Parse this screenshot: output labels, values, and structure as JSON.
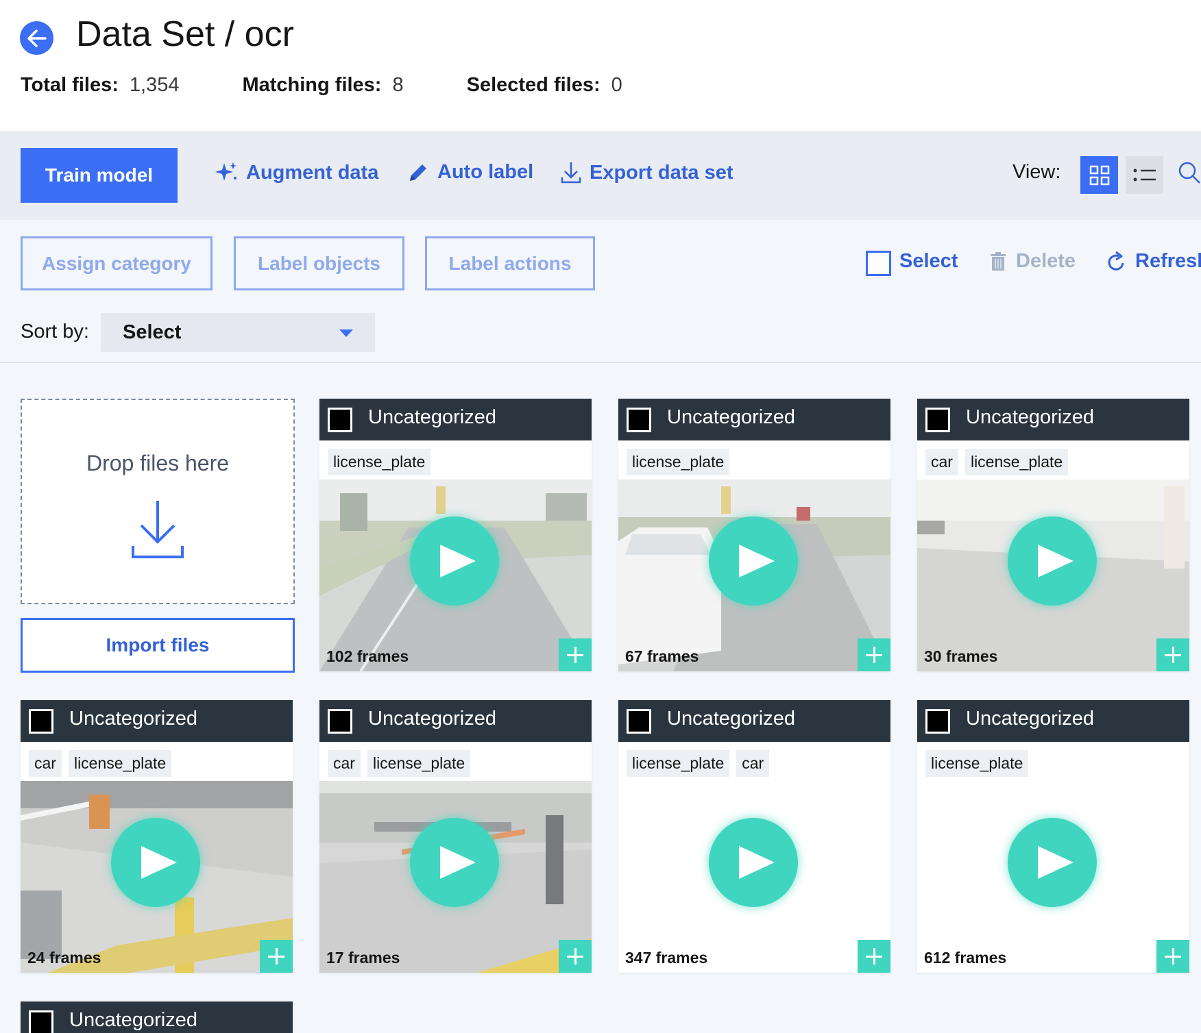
{
  "header": {
    "title": "Data Set / ocr",
    "stats": [
      {
        "label": "Total files:",
        "value": "1,354"
      },
      {
        "label": "Matching files:",
        "value": "8"
      },
      {
        "label": "Selected files:",
        "value": "0"
      }
    ]
  },
  "toolbar": {
    "train_label": "Train model",
    "augment_label": "Augment data",
    "auto_label": "Auto label",
    "export_label": "Export data set",
    "view_label": "View:"
  },
  "actions": {
    "assign_category": "Assign category",
    "label_objects": "Label objects",
    "label_actions": "Label actions",
    "select_label": "Select",
    "delete_label": "Delete",
    "refresh_label": "Refresh"
  },
  "sort": {
    "label": "Sort by:",
    "selected": "Select"
  },
  "dropzone": {
    "text": "Drop files here",
    "import_label": "Import files"
  },
  "colors": {
    "accent": "#3b6ef5",
    "teal": "#3fd5be",
    "card_header": "#2b353f"
  },
  "cards": [
    {
      "category": "Uncategorized",
      "tags": [
        "license_plate"
      ],
      "frames": "102 frames",
      "thumb": "road-barrier"
    },
    {
      "category": "Uncategorized",
      "tags": [
        "license_plate"
      ],
      "frames": "67 frames",
      "thumb": "white-van"
    },
    {
      "category": "Uncategorized",
      "tags": [
        "car",
        "license_plate"
      ],
      "frames": "30 frames",
      "thumb": "garage-entry"
    },
    {
      "category": "Uncategorized",
      "tags": [
        "car",
        "license_plate"
      ],
      "frames": "24 frames",
      "thumb": "parking-barrier"
    },
    {
      "category": "Uncategorized",
      "tags": [
        "car",
        "license_plate"
      ],
      "frames": "17 frames",
      "thumb": "parking-gate"
    },
    {
      "category": "Uncategorized",
      "tags": [
        "license_plate",
        "car"
      ],
      "frames": "347 frames",
      "thumb": "blank"
    },
    {
      "category": "Uncategorized",
      "tags": [
        "license_plate"
      ],
      "frames": "612 frames",
      "thumb": "blank"
    },
    {
      "category": "Uncategorized",
      "tags": [],
      "frames": "",
      "thumb": "partial"
    }
  ]
}
